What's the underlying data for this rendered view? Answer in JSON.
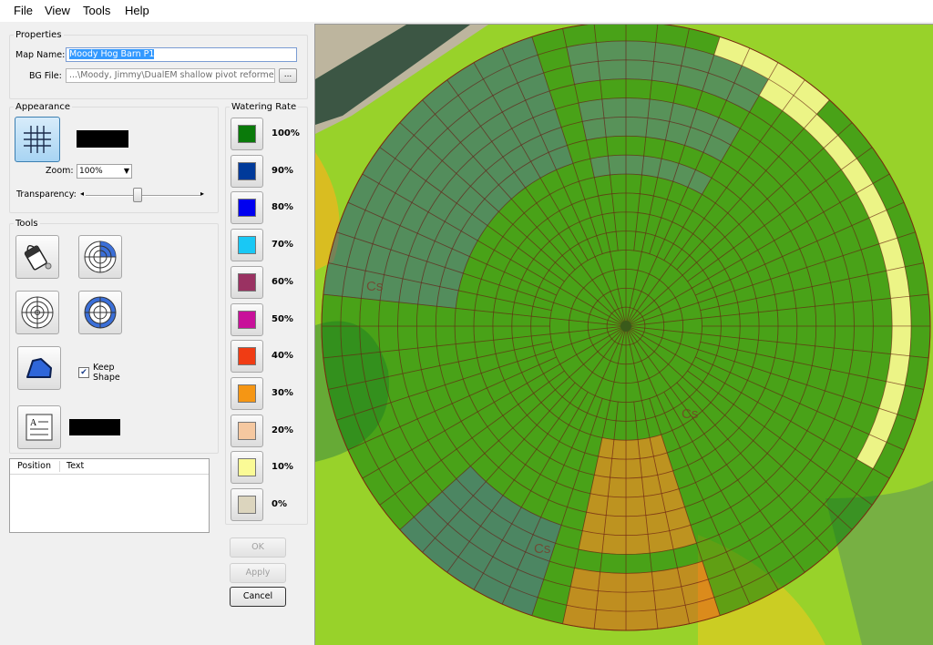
{
  "menu": [
    "File",
    "View",
    "Tools",
    "Help"
  ],
  "properties": {
    "legend": "Properties",
    "map_name_label": "Map Name:",
    "map_name_value": "Moody Hog Barn P1",
    "bg_file_label": "BG File:",
    "bg_file_value": "...\\Moody, Jimmy\\DualEM shallow pivot reformed.jpg",
    "browse_label": "..."
  },
  "appearance": {
    "legend": "Appearance",
    "grid_color": "#000000",
    "zoom_label": "Zoom:",
    "zoom_value": "100%",
    "transparency_label": "Transparency:",
    "transparency_value": 0.45
  },
  "tools": {
    "legend": "Tools",
    "keep_shape_label_1": "Keep",
    "keep_shape_label_2": "Shape",
    "keep_shape_checked": true,
    "text_color": "#000000"
  },
  "annotations_table": {
    "columns": [
      "Position",
      "Text"
    ],
    "rows": []
  },
  "watering_rate": {
    "legend": "Watering Rate",
    "rates": [
      {
        "label": "100%",
        "color": "#0a7a0a"
      },
      {
        "label": "90%",
        "color": "#003a9a"
      },
      {
        "label": "80%",
        "color": "#0000f0"
      },
      {
        "label": "70%",
        "color": "#19c8f5"
      },
      {
        "label": "60%",
        "color": "#9a3262"
      },
      {
        "label": "50%",
        "color": "#c8109a"
      },
      {
        "label": "40%",
        "color": "#f03c14"
      },
      {
        "label": "30%",
        "color": "#f59614"
      },
      {
        "label": "20%",
        "color": "#f5c8a0"
      },
      {
        "label": "10%",
        "color": "#fafa96"
      },
      {
        "label": "0%",
        "color": "#dcd5be"
      }
    ]
  },
  "buttons": {
    "ok": "OK",
    "apply": "Apply",
    "cancel": "Cancel"
  },
  "map": {
    "background_color": "#98d22a",
    "pivot_rings": 16,
    "pivot_sectors": 60,
    "soil_labels": [
      "Cs",
      "Cs",
      "Cs"
    ]
  }
}
